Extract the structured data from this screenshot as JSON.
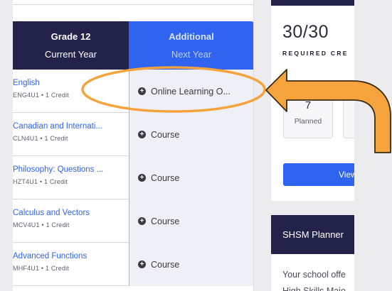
{
  "planner": {
    "current_header": {
      "grade": "Grade 12",
      "year": "Current Year"
    },
    "next_header": {
      "title": "Additional",
      "year": "Next Year"
    },
    "rows": [
      {
        "name": "English",
        "meta": "ENG4U1 • 1 Credit",
        "slot": "Online Learning O..."
      },
      {
        "name": "Canadian and Internati...",
        "meta": "CLN4U1 • 1 Credit",
        "slot": "Course"
      },
      {
        "name": "Philosophy: Questions ...",
        "meta": "HZT4U1 • 1 Credit",
        "slot": "Course"
      },
      {
        "name": "Calculus and Vectors",
        "meta": "MCV4U1 • 1 Credit",
        "slot": "Course"
      },
      {
        "name": "Advanced Functions",
        "meta": "MHF4U1 • 1 Credit",
        "slot": "Course"
      }
    ]
  },
  "credits": {
    "ratio": "30/30",
    "required_label": "REQUIRED CRE",
    "planned_count": "7",
    "planned_label": "Planned",
    "view_button": "View"
  },
  "shsm": {
    "title": "SHSM Planner",
    "body_line1": "Your school offe",
    "body_line2": "High Skills Majo"
  },
  "colors": {
    "navy": "#22224a",
    "accent_blue": "#2f63f0",
    "highlight_orange": "#f5a33c"
  },
  "icons": {
    "add": "plus-circle-icon",
    "annotation_arrow": "curved-arrow-icon"
  }
}
